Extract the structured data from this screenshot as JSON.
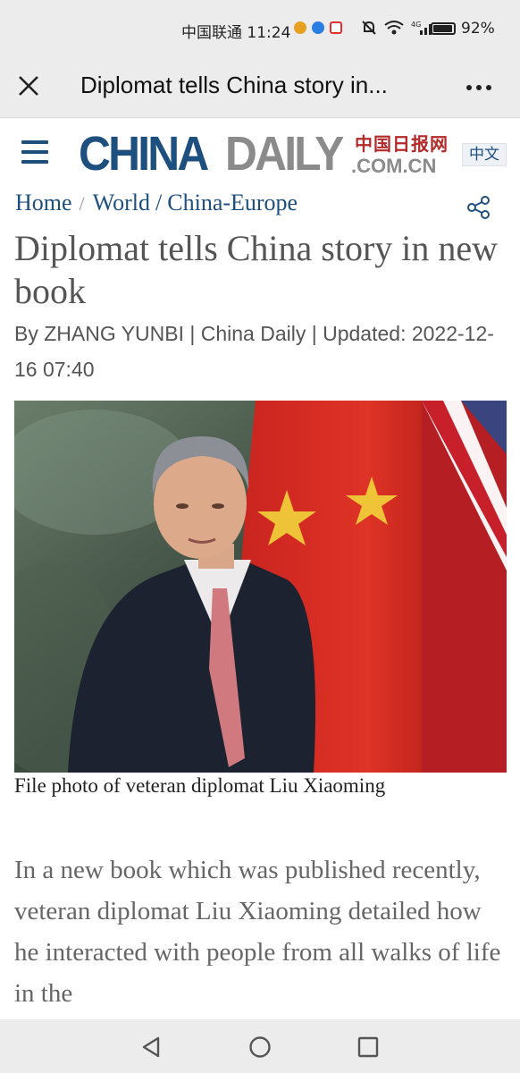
{
  "status_bar": {
    "carrier_time": "中国联通 11:24",
    "battery": "92%",
    "app_icon_colors": [
      "#e8a020",
      "#2a7de1",
      "#e03030"
    ]
  },
  "title_bar": {
    "title": "Diplomat tells China story in..."
  },
  "header": {
    "logo_primary": "CHINA",
    "logo_secondary": "DAILY",
    "logo_chinese": "中国日报网",
    "logo_domain": ".COM.CN",
    "language_button": "中文"
  },
  "breadcrumb": {
    "home": "Home",
    "world": "World",
    "section": "China-Europe"
  },
  "article": {
    "headline": "Diplomat tells China story in new book",
    "byline": "By ZHANG YUNBI | China Daily | Updated: 2022-12-16 07:40",
    "photo_caption": "File photo of veteran diplomat Liu Xiaoming",
    "body": "In a new book which was published recently, veteran diplomat Liu Xiaoming detailed how he interacted with people from all walks of life in the"
  },
  "colors": {
    "brand_blue": "#1d4f7f",
    "brand_gray": "#8b8b8b",
    "brand_red": "#b22a2a"
  }
}
